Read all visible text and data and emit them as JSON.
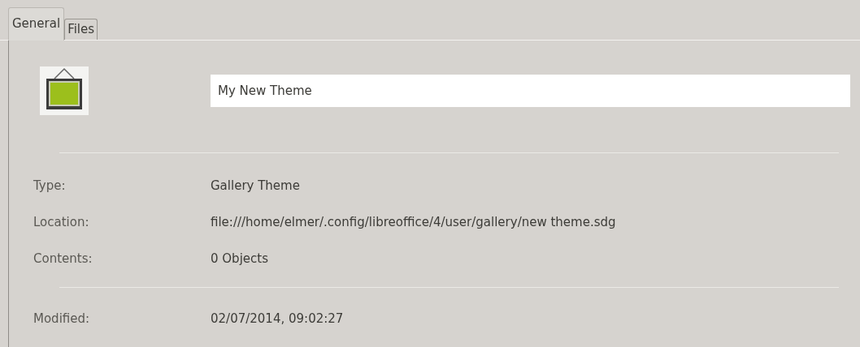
{
  "tabs": [
    {
      "label": "General",
      "selected": true
    },
    {
      "label": "Files",
      "selected": false
    }
  ],
  "theme_name": {
    "value": "My New Theme"
  },
  "info_rows": [
    {
      "label": "Type:",
      "value": "Gallery Theme"
    },
    {
      "label": "Location:",
      "value": "file:///home/elmer/.config/libreoffice/4/user/gallery/new theme.sdg"
    },
    {
      "label": "Contents:",
      "value": "0 Objects"
    }
  ],
  "date_rows": [
    {
      "label": "Modified:",
      "value": "02/07/2014, 09:02:27"
    }
  ]
}
